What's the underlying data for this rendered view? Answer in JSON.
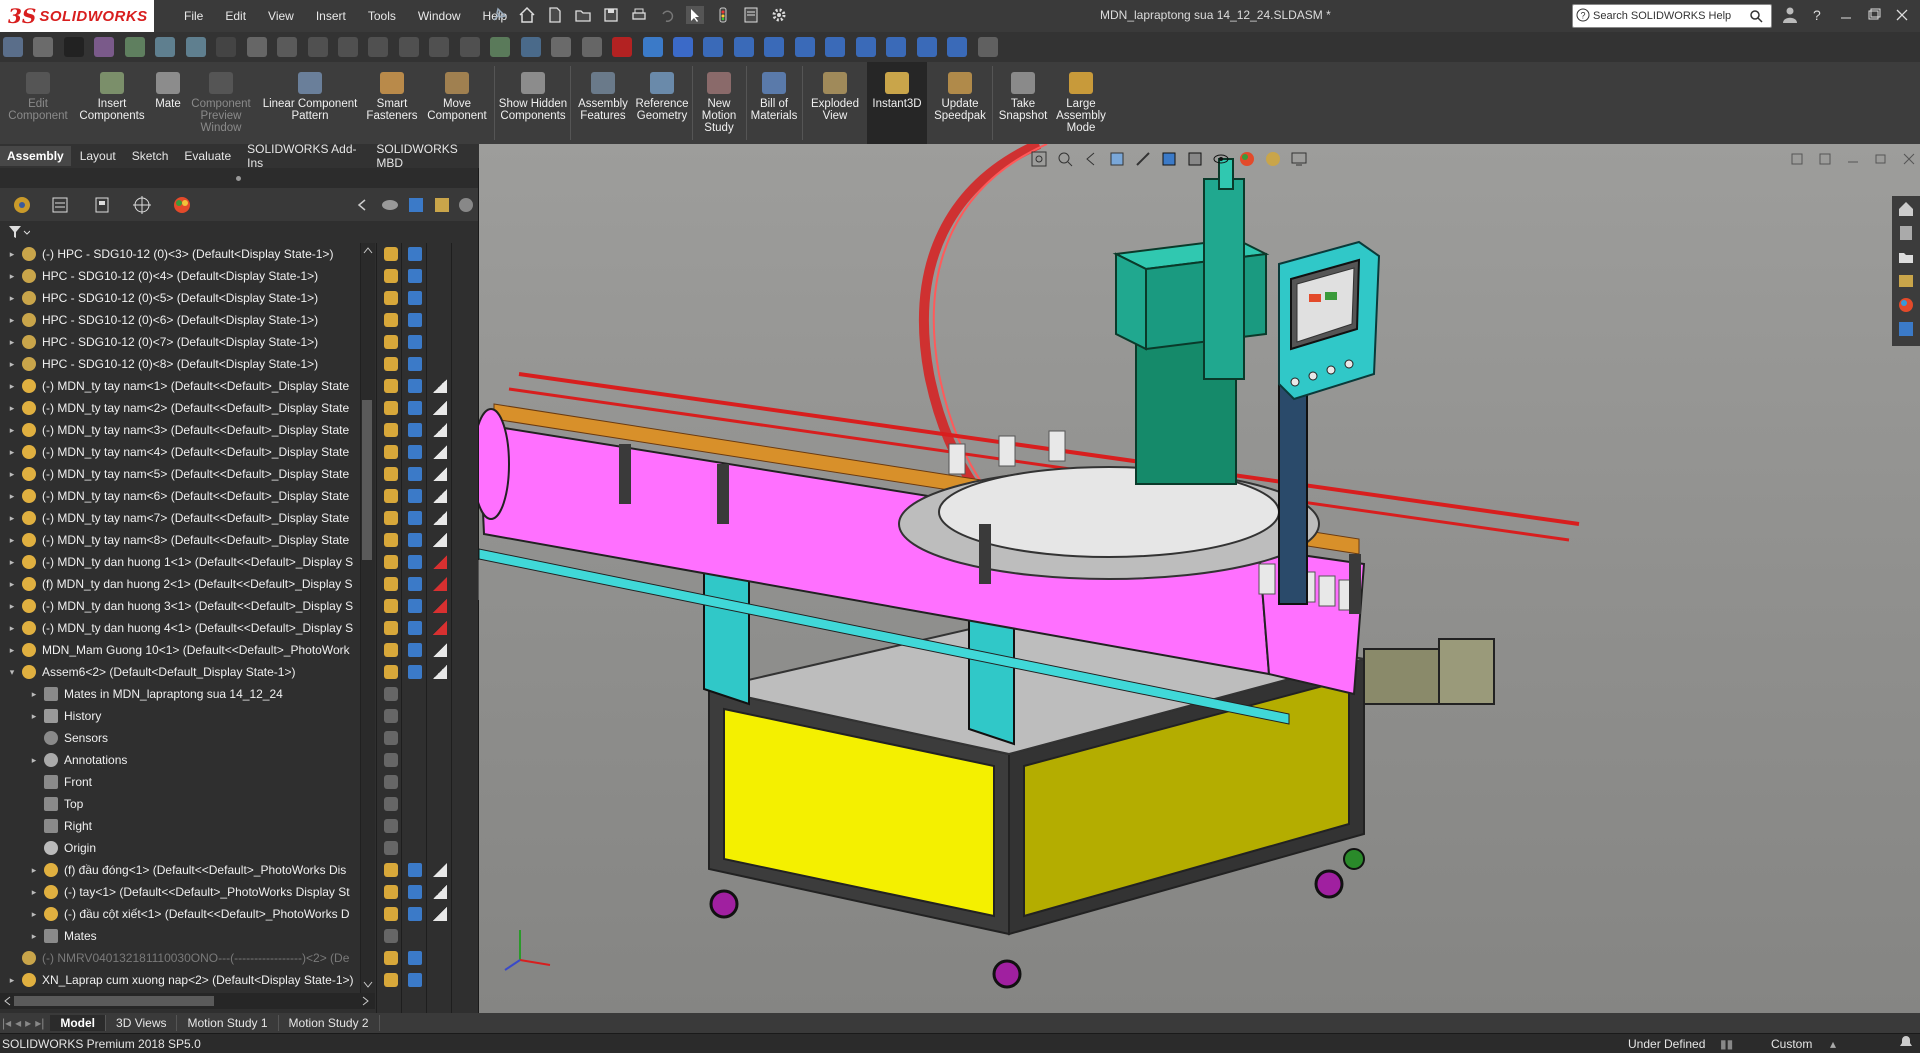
{
  "app": {
    "name": "SOLIDWORKS",
    "document_title": "MDN_lapraptong sua 14_12_24.SLDASM *"
  },
  "menu": [
    "File",
    "Edit",
    "View",
    "Insert",
    "Tools",
    "Window",
    "Help"
  ],
  "search": {
    "placeholder": "Search SOLIDWORKS Help"
  },
  "command_manager": [
    {
      "label": "Edit Component",
      "enabled": false
    },
    {
      "label": "Insert Components",
      "enabled": true
    },
    {
      "label": "Mate",
      "enabled": true
    },
    {
      "label": "Component Preview Window",
      "enabled": false
    },
    {
      "label": "Linear Component Pattern",
      "enabled": true
    },
    {
      "label": "Smart Fasteners",
      "enabled": true
    },
    {
      "label": "Move Component",
      "enabled": true
    },
    {
      "label": "Show Hidden Components",
      "enabled": true
    },
    {
      "label": "Assembly Features",
      "enabled": true
    },
    {
      "label": "Reference Geometry",
      "enabled": true
    },
    {
      "label": "New Motion Study",
      "enabled": true
    },
    {
      "label": "Bill of Materials",
      "enabled": true
    },
    {
      "label": "Exploded View",
      "enabled": true
    },
    {
      "label": "Instant3D",
      "enabled": true
    },
    {
      "label": "Update Speedpak",
      "enabled": true
    },
    {
      "label": "Take Snapshot",
      "enabled": true
    },
    {
      "label": "Large Assembly Mode",
      "enabled": true
    }
  ],
  "ribbon_tabs": [
    {
      "label": "Assembly",
      "active": true
    },
    {
      "label": "Layout",
      "active": false
    },
    {
      "label": "Sketch",
      "active": false
    },
    {
      "label": "Evaluate",
      "active": false
    },
    {
      "label": "SOLIDWORKS Add-Ins",
      "active": false
    },
    {
      "label": "SOLIDWORKS MBD",
      "active": false
    }
  ],
  "tree": [
    {
      "label": "(-) HPC - SDG10-12 (0)<3> (Default<Display State-1>)",
      "level": 0,
      "icon": "part-icon"
    },
    {
      "label": "HPC - SDG10-12 (0)<4> (Default<Display State-1>)",
      "level": 0,
      "icon": "part-icon"
    },
    {
      "label": "HPC - SDG10-12 (0)<5> (Default<Display State-1>)",
      "level": 0,
      "icon": "part-icon"
    },
    {
      "label": "HPC - SDG10-12 (0)<6> (Default<Display State-1>)",
      "level": 0,
      "icon": "part-icon"
    },
    {
      "label": "HPC - SDG10-12 (0)<7> (Default<Display State-1>)",
      "level": 0,
      "icon": "part-icon"
    },
    {
      "label": "HPC - SDG10-12 (0)<8> (Default<Display State-1>)",
      "level": 0,
      "icon": "part-icon"
    },
    {
      "label": "(-) MDN_ty tay nam<1> (Default<<Default>_Display State",
      "level": 0,
      "icon": "assembly-icon"
    },
    {
      "label": "(-) MDN_ty tay nam<2> (Default<<Default>_Display State",
      "level": 0,
      "icon": "assembly-icon"
    },
    {
      "label": "(-) MDN_ty tay nam<3> (Default<<Default>_Display State",
      "level": 0,
      "icon": "assembly-icon"
    },
    {
      "label": "(-) MDN_ty tay nam<4> (Default<<Default>_Display State",
      "level": 0,
      "icon": "assembly-icon"
    },
    {
      "label": "(-) MDN_ty tay nam<5> (Default<<Default>_Display State",
      "level": 0,
      "icon": "assembly-icon"
    },
    {
      "label": "(-) MDN_ty tay nam<6> (Default<<Default>_Display State",
      "level": 0,
      "icon": "assembly-icon"
    },
    {
      "label": "(-) MDN_ty tay nam<7> (Default<<Default>_Display State",
      "level": 0,
      "icon": "assembly-icon"
    },
    {
      "label": "(-) MDN_ty tay nam<8> (Default<<Default>_Display State",
      "level": 0,
      "icon": "assembly-icon"
    },
    {
      "label": "(-) MDN_ty dan huong 1<1> (Default<<Default>_Display S",
      "level": 0,
      "icon": "assembly-icon"
    },
    {
      "label": "(f) MDN_ty dan huong 2<1> (Default<<Default>_Display S",
      "level": 0,
      "icon": "assembly-icon"
    },
    {
      "label": "(-) MDN_ty dan huong 3<1> (Default<<Default>_Display S",
      "level": 0,
      "icon": "assembly-icon"
    },
    {
      "label": "(-) MDN_ty dan huong 4<1> (Default<<Default>_Display S",
      "level": 0,
      "icon": "assembly-icon"
    },
    {
      "label": "MDN_Mam Guong 10<1> (Default<<Default>_PhotoWork",
      "level": 0,
      "icon": "assembly-icon"
    },
    {
      "label": "Assem6<2> (Default<Default_Display State-1>)",
      "level": 0,
      "icon": "assembly-icon",
      "expanded": true
    },
    {
      "label": "Mates in MDN_lapraptong sua 14_12_24",
      "level": 1,
      "icon": "mates-icon"
    },
    {
      "label": "History",
      "level": 1,
      "icon": "history-icon"
    },
    {
      "label": "Sensors",
      "level": 1,
      "icon": "sensor-icon",
      "nocaret": true
    },
    {
      "label": "Annotations",
      "level": 1,
      "icon": "annotation-icon"
    },
    {
      "label": "Front",
      "level": 1,
      "icon": "plane-icon",
      "nocaret": true
    },
    {
      "label": "Top",
      "level": 1,
      "icon": "plane-icon",
      "nocaret": true
    },
    {
      "label": "Right",
      "level": 1,
      "icon": "plane-icon",
      "nocaret": true
    },
    {
      "label": "Origin",
      "level": 1,
      "icon": "origin-icon",
      "nocaret": true
    },
    {
      "label": "(f) đầu đóng<1> (Default<<Default>_PhotoWorks Dis",
      "level": 1,
      "icon": "assembly-icon"
    },
    {
      "label": "(-) tay<1> (Default<<Default>_PhotoWorks Display St",
      "level": 1,
      "icon": "assembly-icon"
    },
    {
      "label": "(-) đầu cột xiết<1> (Default<<Default>_PhotoWorks D",
      "level": 1,
      "icon": "assembly-icon"
    },
    {
      "label": "Mates",
      "level": 1,
      "icon": "mates-icon"
    },
    {
      "label": "(-) NMRV040132181110030ONO---(-----------------)<2> (De",
      "level": 0,
      "icon": "part-icon",
      "dim": true,
      "nocaret": true
    },
    {
      "label": "XN_Laprap cum xuong nap<2> (Default<Display State-1>)",
      "level": 0,
      "icon": "assembly-icon"
    }
  ],
  "bottom_tabs": [
    {
      "label": "Model",
      "active": true
    },
    {
      "label": "3D Views",
      "active": false
    },
    {
      "label": "Motion Study 1",
      "active": false
    },
    {
      "label": "Motion Study 2",
      "active": false
    }
  ],
  "status": {
    "product": "SOLIDWORKS Premium 2018 SP5.0",
    "state": "Under Defined",
    "units": "Custom"
  },
  "colors": {
    "conveyor": "#ff70ff",
    "base": "#ffff00",
    "machine_head": "#20a88f",
    "panel": "#30c8c8",
    "chain": "#d8902a",
    "rail": "#d81e1e"
  }
}
